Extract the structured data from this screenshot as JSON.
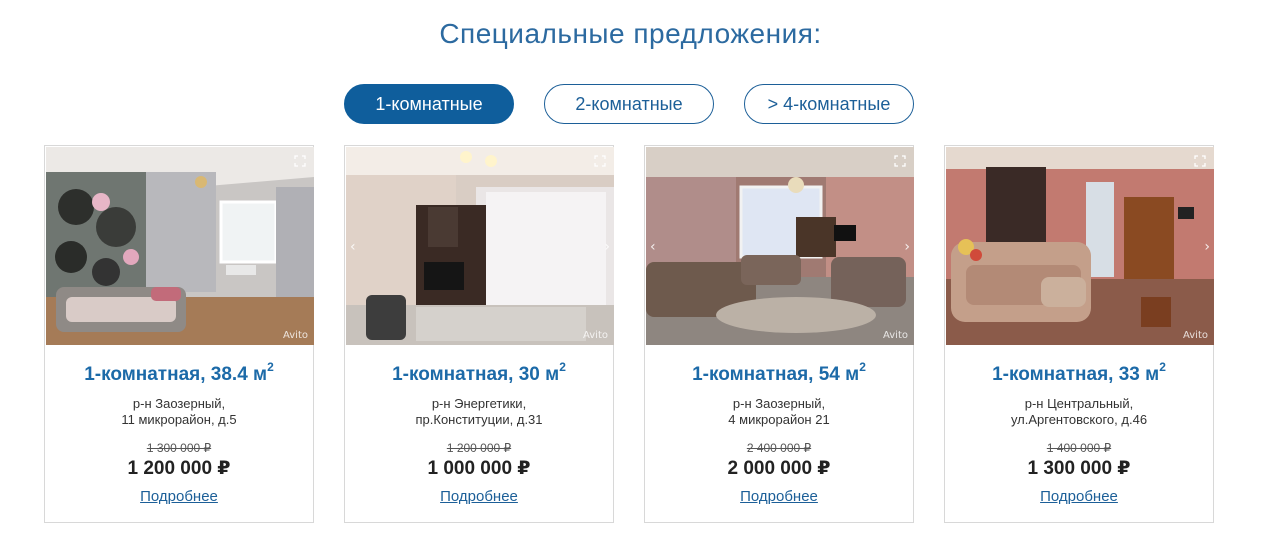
{
  "heading": "Специальные предложения:",
  "tabs": [
    {
      "label": "1-комнатные",
      "active": true
    },
    {
      "label": "2-комнатные",
      "active": false
    },
    {
      "label": "> 4-комнатные",
      "active": false
    }
  ],
  "cards": [
    {
      "title": "1-комнатная, 38.4 м",
      "unit_sup": "2",
      "address_line1": "р-н Заозерный,",
      "address_line2": "11 микрорайон, д.5",
      "old_price": "1 300 000 ₽",
      "price": "1 200 000 ₽",
      "link": "Подробнее",
      "watermark": "Avito"
    },
    {
      "title": "1-комнатная, 30 м",
      "unit_sup": "2",
      "address_line1": "р-н Энергетики,",
      "address_line2": "пр.Конституции, д.31",
      "old_price": "1 200 000 ₽",
      "price": "1 000 000 ₽",
      "link": "Подробнее",
      "watermark": "Avito"
    },
    {
      "title": "1-комнатная, 54 м",
      "unit_sup": "2",
      "address_line1": "р-н Заозерный,",
      "address_line2": "4 микрорайон 21",
      "old_price": "2 400 000 ₽",
      "price": "2 000 000 ₽",
      "link": "Подробнее",
      "watermark": "Avito"
    },
    {
      "title": "1-комнатная, 33 м",
      "unit_sup": "2",
      "address_line1": "р-н Центральный,",
      "address_line2": "ул.Аргентовского, д.46",
      "old_price": "1 400 000 ₽",
      "price": "1 300 000 ₽",
      "link": "Подробнее",
      "watermark": "Avito"
    }
  ],
  "colors": {
    "accent": "#0f5e9c",
    "title_blue": "#1c6aa8",
    "heading_blue": "#2c6aa0"
  }
}
